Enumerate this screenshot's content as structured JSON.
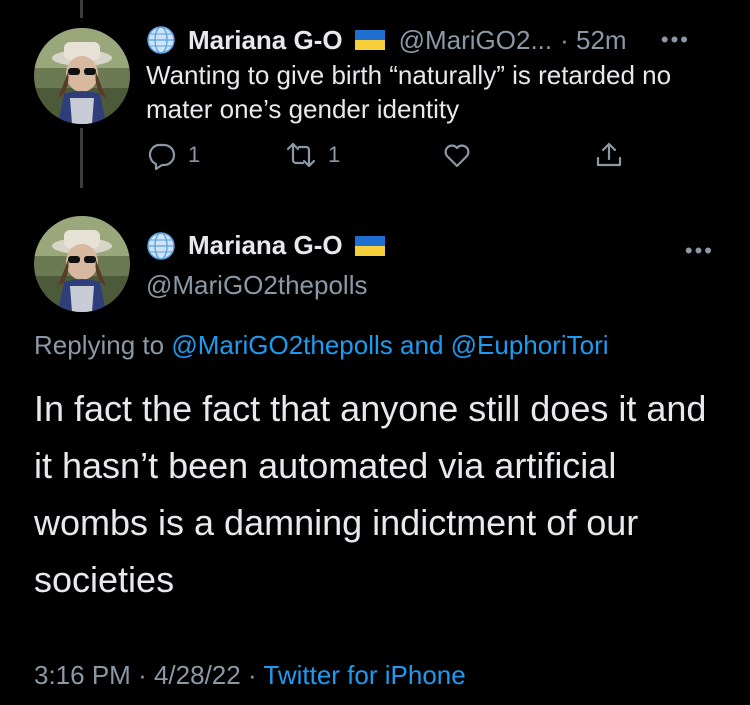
{
  "tweet1": {
    "name": "Mariana G-O",
    "handle": "@MariGO2...",
    "time": "· 52m",
    "more": "•••",
    "text": "Wanting to give birth “naturally” is retarded no mater one’s gender identity",
    "reply_count": "1",
    "retweet_count": "1"
  },
  "tweet2": {
    "name": "Mariana G-O",
    "handle": "@MariGO2thepolls",
    "more": "•••",
    "replying_prefix": "Replying to ",
    "replying_user1": "@MariGO2thepolls",
    "replying_and": " and ",
    "replying_user2": "@EuphoriTori",
    "text": "In fact the fact that anyone still does it and it hasn’t been automated via artificial wombs is a damning indictment of our societies",
    "time": "3:16 PM",
    "date": "4/28/22",
    "separator": "·",
    "source": "Twitter for iPhone"
  },
  "colors": {
    "background": "#000000",
    "text": "#e7e9ea",
    "muted": "#8b98a5",
    "link": "#1d9bf0"
  },
  "icons": [
    "globe-icon",
    "ukraine-flag-icon",
    "reply-icon",
    "retweet-icon",
    "like-icon",
    "share-icon",
    "more-icon"
  ]
}
